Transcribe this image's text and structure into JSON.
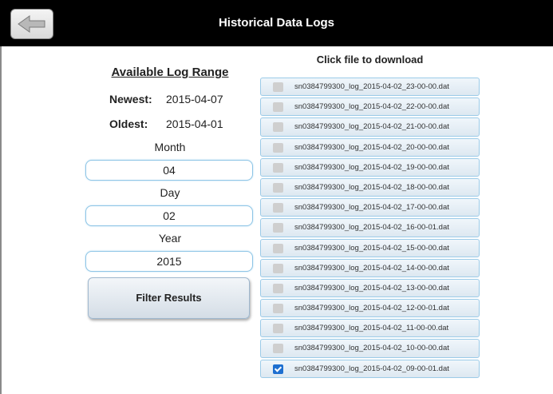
{
  "header": {
    "title": "Historical Data Logs",
    "back_icon": "arrow-left-icon"
  },
  "range": {
    "title": "Available Log Range",
    "newest_label": "Newest:",
    "newest_value": "2015-04-07",
    "oldest_label": "Oldest:",
    "oldest_value": "2015-04-01"
  },
  "filters": {
    "month_label": "Month",
    "month_value": "04",
    "day_label": "Day",
    "day_value": "02",
    "year_label": "Year",
    "year_value": "2015",
    "button_label": "Filter Results"
  },
  "files": {
    "title": "Click file to download",
    "items": [
      {
        "name": "sn0384799300_log_2015-04-02_23-00-00.dat",
        "checked": false
      },
      {
        "name": "sn0384799300_log_2015-04-02_22-00-00.dat",
        "checked": false
      },
      {
        "name": "sn0384799300_log_2015-04-02_21-00-00.dat",
        "checked": false
      },
      {
        "name": "sn0384799300_log_2015-04-02_20-00-00.dat",
        "checked": false
      },
      {
        "name": "sn0384799300_log_2015-04-02_19-00-00.dat",
        "checked": false
      },
      {
        "name": "sn0384799300_log_2015-04-02_18-00-00.dat",
        "checked": false
      },
      {
        "name": "sn0384799300_log_2015-04-02_17-00-00.dat",
        "checked": false
      },
      {
        "name": "sn0384799300_log_2015-04-02_16-00-01.dat",
        "checked": false
      },
      {
        "name": "sn0384799300_log_2015-04-02_15-00-00.dat",
        "checked": false
      },
      {
        "name": "sn0384799300_log_2015-04-02_14-00-00.dat",
        "checked": false
      },
      {
        "name": "sn0384799300_log_2015-04-02_13-00-00.dat",
        "checked": false
      },
      {
        "name": "sn0384799300_log_2015-04-02_12-00-01.dat",
        "checked": false
      },
      {
        "name": "sn0384799300_log_2015-04-02_11-00-00.dat",
        "checked": false
      },
      {
        "name": "sn0384799300_log_2015-04-02_10-00-00.dat",
        "checked": false
      },
      {
        "name": "sn0384799300_log_2015-04-02_09-00-01.dat",
        "checked": true
      }
    ]
  },
  "colors": {
    "header_bg": "#000000",
    "accent_border": "#8ec5e6",
    "checkbox_checked": "#1e6fd0"
  }
}
